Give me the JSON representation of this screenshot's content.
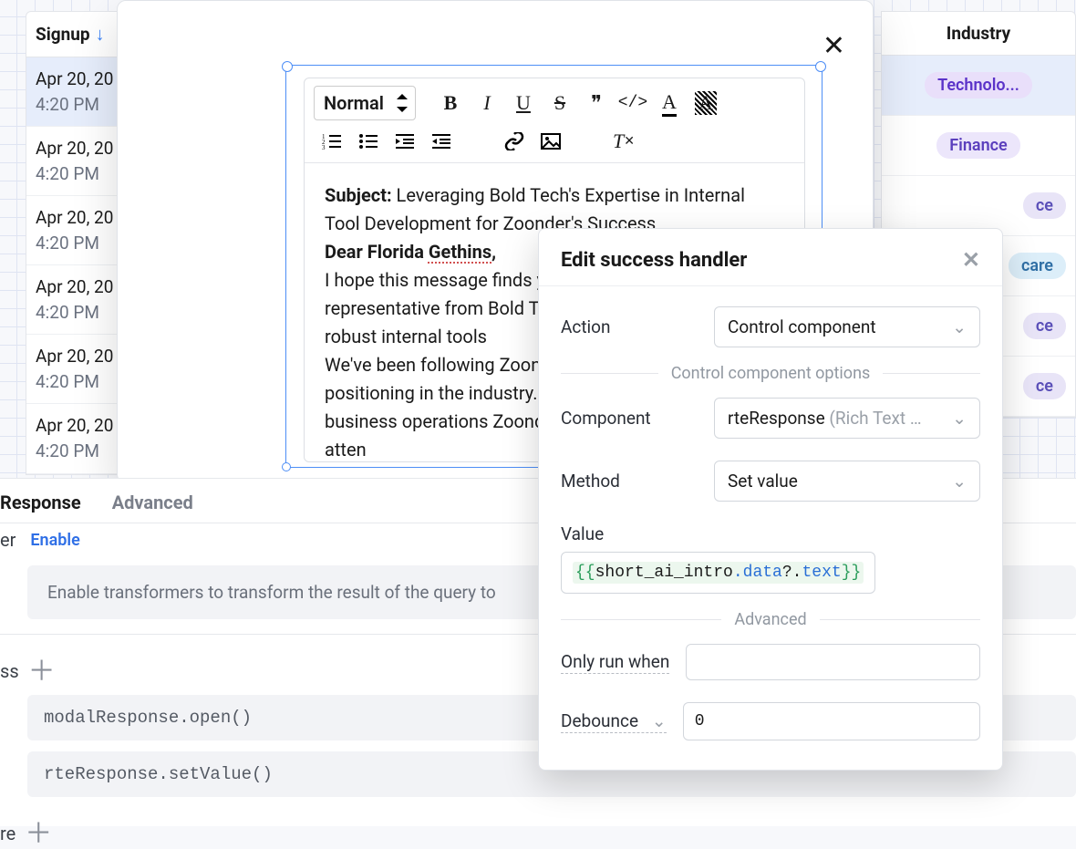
{
  "columns": {
    "signup": {
      "header": "Signup",
      "sort": "asc",
      "rows": [
        {
          "date": "Apr 20, 20",
          "time": "4:20 PM",
          "selected": true
        },
        {
          "date": "Apr 20, 20",
          "time": "4:20 PM"
        },
        {
          "date": "Apr 20, 20",
          "time": "4:20 PM"
        },
        {
          "date": "Apr 20, 20",
          "time": "4:20 PM"
        },
        {
          "date": "Apr 20, 20",
          "time": "4:20 PM"
        },
        {
          "date": "Apr 20, 20",
          "time": "4:20 PM"
        }
      ]
    },
    "industry": {
      "header": "Industry",
      "rows": [
        {
          "label": "Technolo...",
          "variant": "tech"
        },
        {
          "label": "Finance",
          "variant": "fin"
        },
        {
          "label": "ce",
          "variant": "ce"
        },
        {
          "label": "care",
          "variant": "hc"
        },
        {
          "label": "ce",
          "variant": "ce"
        },
        {
          "label": "ce",
          "variant": "ce"
        }
      ]
    }
  },
  "editor": {
    "format_label": "Normal",
    "subject_prefix": "Subject:",
    "subject_text": " Leveraging Bold Tech's Expertise in Internal Tool Development for Zoonder's Success",
    "greeting": "Dear Florida Gethins,",
    "para1": " I hope this message finds you well. My am a representative from Bold Tech, an the development of robust internal tools",
    "para2": " We've been following Zoonder's impres market positioning in the industry. Your i breakthrough in the business operations Zoonder's success has caught our atten"
  },
  "popover": {
    "title": "Edit success handler",
    "fields": {
      "action_label": "Action",
      "action_value": "Control component",
      "options_header": "Control component options",
      "component_label": "Component",
      "component_value": "rteResponse",
      "component_hint": "(Rich Text …",
      "method_label": "Method",
      "method_value": "Set value",
      "value_label": "Value",
      "value_code": "{{short_ai_intro.data?.text}}",
      "advanced_header": "Advanced",
      "only_run_label": "Only run when",
      "debounce_label": "Debounce",
      "debounce_value": "0"
    }
  },
  "lower": {
    "tabs": {
      "response": "Response",
      "advanced": "Advanced"
    },
    "transform_trail": "er",
    "enable": "Enable",
    "info_text": "Enable transformers to transform the result of the query to",
    "success_trail": "ss",
    "re_trail": "re",
    "handlers": [
      "modalResponse.open()",
      "rteResponse.setValue()"
    ]
  }
}
